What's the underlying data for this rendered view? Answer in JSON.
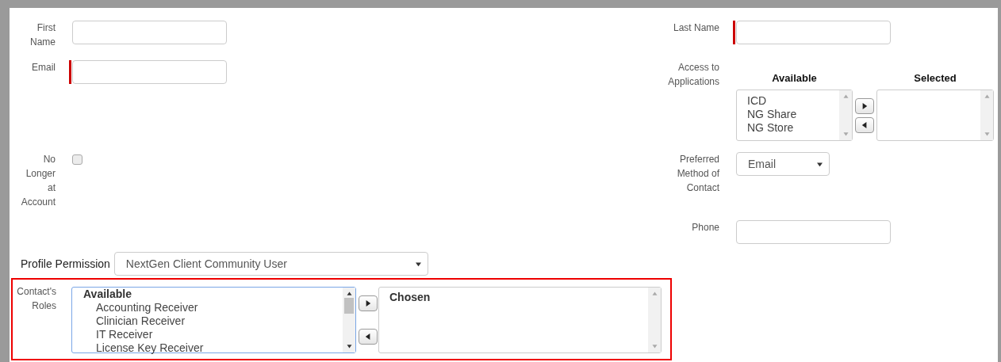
{
  "form": {
    "rows": [
      {
        "left": {
          "kind": "text",
          "label": "First Name",
          "required": false
        },
        "right": {
          "kind": "text",
          "label": "Last Name",
          "required": true
        }
      },
      {
        "left": {
          "kind": "text",
          "label": "Email",
          "required": true
        },
        "right": {
          "kind": "dual_list",
          "label": "Access to Applications",
          "available_heading": "Available",
          "selected_heading": "Selected",
          "available": [
            "ICD",
            "NG Share",
            "NG Store"
          ]
        }
      },
      {
        "left": {
          "kind": "checkbox",
          "label": "No Longer at Account",
          "checked": false
        },
        "right": {
          "kind": "select",
          "label": "Preferred Method of Contact",
          "value": "Email"
        }
      },
      {
        "right": {
          "kind": "text",
          "label": "Phone",
          "required": false
        }
      }
    ]
  },
  "profile_permission": {
    "label": "Profile Permission",
    "value": "NextGen Client Community User"
  },
  "contacts_roles": {
    "label": "Contact's Roles",
    "highlighted": true,
    "focused": true,
    "available_heading": "Available",
    "available": [
      "Accounting Receiver",
      "Clinician Receiver",
      "IT Receiver",
      "License Key Receiver"
    ],
    "chosen_heading": "Chosen"
  }
}
